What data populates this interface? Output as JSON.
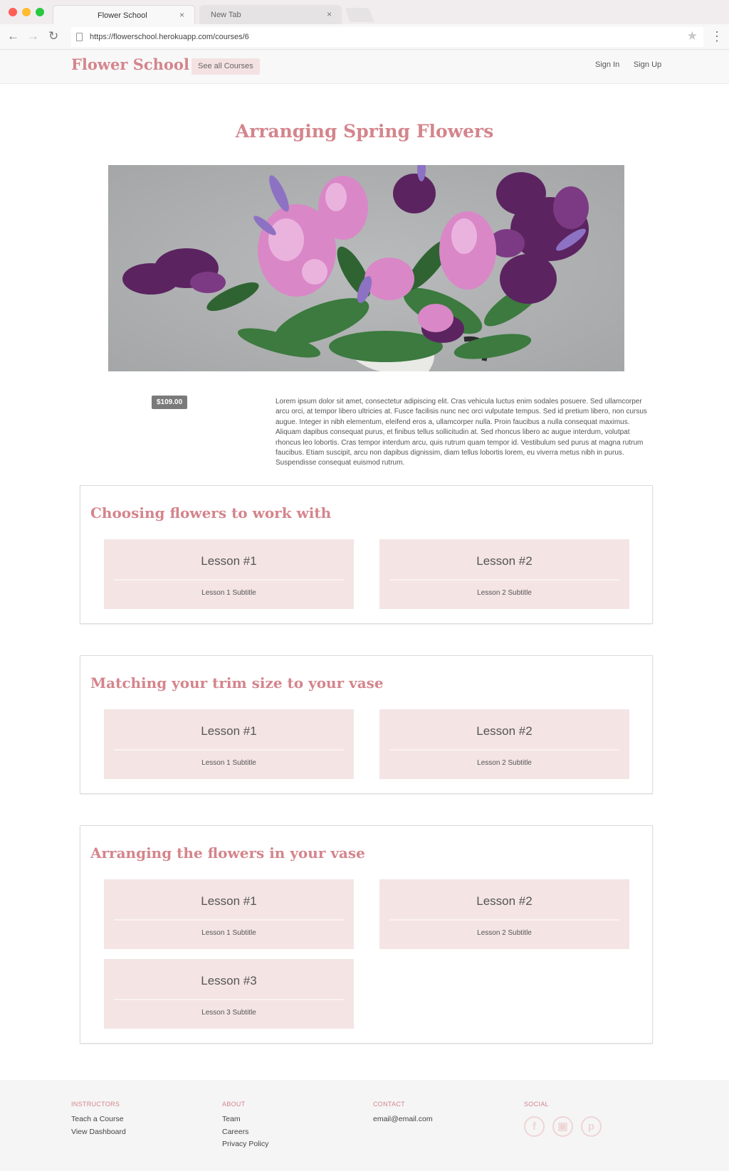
{
  "browser": {
    "tabs": [
      {
        "label": "Flower School"
      },
      {
        "label": "New Tab"
      }
    ],
    "close_glyph": "×",
    "url": "https://flowerschool.herokuapp.com/courses/6"
  },
  "header": {
    "logo": "Flower School",
    "see_all": "See all Courses",
    "sign_in": "Sign In",
    "sign_up": "Sign Up"
  },
  "course": {
    "title": "Arranging Spring Flowers",
    "price": "$109.00",
    "description": "Lorem ipsum dolor sit amet, consectetur adipiscing elit. Cras vehicula luctus enim sodales posuere. Sed ullamcorper arcu orci, at tempor libero ultricies at. Fusce facilisis nunc nec orci vulputate tempus. Sed id pretium libero, non cursus augue. Integer in nibh elementum, eleifend eros a, ullamcorper nulla. Proin faucibus a nulla consequat maximus. Aliquam dapibus consequat purus, et finibus tellus sollicitudin at. Sed rhoncus libero ac augue interdum, volutpat rhoncus leo lobortis. Cras tempor interdum arcu, quis rutrum quam tempor id. Vestibulum sed purus at magna rutrum faucibus. Etiam suscipit, arcu non dapibus dignissim, diam tellus lobortis lorem, eu viverra metus nibh in purus. Suspendisse consequat euismod rutrum."
  },
  "sections": [
    {
      "title": "Choosing flowers to work with",
      "lessons": [
        {
          "title": "Lesson #1",
          "subtitle": "Lesson 1 Subtitle"
        },
        {
          "title": "Lesson #2",
          "subtitle": "Lesson 2 Subtitle"
        }
      ]
    },
    {
      "title": "Matching your trim size to your vase",
      "lessons": [
        {
          "title": "Lesson #1",
          "subtitle": "Lesson 1 Subtitle"
        },
        {
          "title": "Lesson #2",
          "subtitle": "Lesson 2 Subtitle"
        }
      ]
    },
    {
      "title": "Arranging the flowers in your vase",
      "lessons": [
        {
          "title": "Lesson #1",
          "subtitle": "Lesson 1 Subtitle"
        },
        {
          "title": "Lesson #2",
          "subtitle": "Lesson 2 Subtitle"
        },
        {
          "title": "Lesson #3",
          "subtitle": "Lesson 3 Subtitle"
        }
      ]
    }
  ],
  "footer": {
    "instructors": {
      "heading": "INSTRUCTORS",
      "links": [
        "Teach a Course",
        "View Dashboard"
      ]
    },
    "about": {
      "heading": "ABOUT",
      "links": [
        "Team",
        "Careers",
        "Privacy Policy"
      ]
    },
    "contact": {
      "heading": "CONTACT",
      "links": [
        "email@email.com"
      ]
    },
    "social": {
      "heading": "SOCIAL",
      "icons": [
        "facebook-icon",
        "instagram-icon",
        "pinterest-icon"
      ]
    }
  },
  "colors": {
    "brand": "#d4858c",
    "card": "#f4e4e4",
    "badge": "#7a7a7a"
  }
}
